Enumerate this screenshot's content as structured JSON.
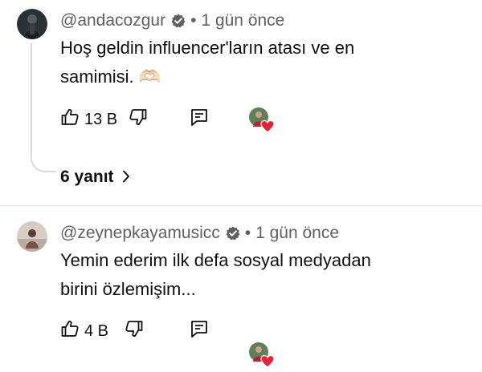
{
  "comments": [
    {
      "handle": "@andacozgur",
      "time": "1 gün önce",
      "text_line1": "Hoş geldin influencer'ların atası ve en",
      "text_line2": "samimisi. 🫶🏻",
      "likes": "13 B",
      "replies_label": "6 yanıt"
    },
    {
      "handle": "@zeynepkayamusicc",
      "time": "1 gün önce",
      "text_line1": "Yemin ederim ilk defa sosyal medyadan",
      "text_line2": "birini özlemişim...",
      "likes": "4 B"
    }
  ],
  "separator": "•",
  "icons": {
    "like": "thumbs-up-icon",
    "dislike": "thumbs-down-icon",
    "reply": "reply-comment-icon",
    "verified": "verified-badge-icon",
    "creator_heart": "creator-heart-icon",
    "chevron": "chevron-right-icon"
  },
  "colors": {
    "heart": "#e0243a",
    "secondary_text": "#606060",
    "primary_text": "#0f0f0f"
  }
}
